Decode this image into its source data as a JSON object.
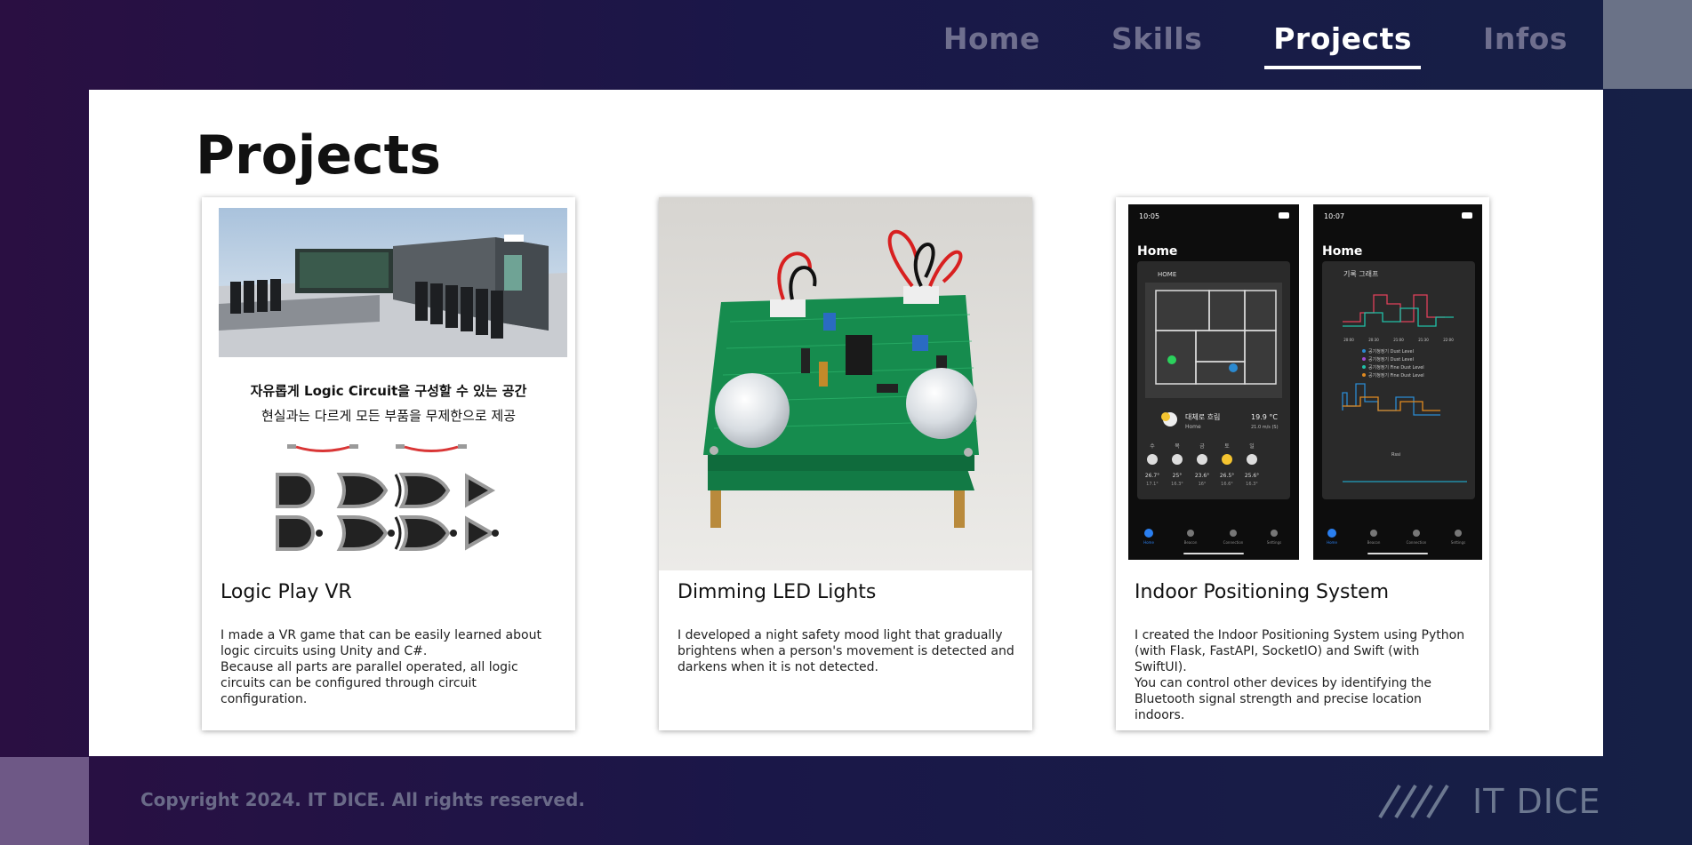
{
  "nav": {
    "items": [
      {
        "label": "Home"
      },
      {
        "label": "Skills"
      },
      {
        "label": "Projects"
      },
      {
        "label": "Infos"
      }
    ],
    "active": "Projects"
  },
  "page": {
    "title": "Projects"
  },
  "projects": [
    {
      "title": "Logic Play VR",
      "image_caption_line1": "자유롭게 Logic Circuit을 구성할 수 있는 공간",
      "image_caption_line2": "현실과는 다르게 모든 부품을 무제한으로 제공",
      "description": "I made a VR game that can be easily learned about logic circuits using Unity and C#.\nBecause all parts are parallel operated, all logic circuits can be configured through circuit configuration."
    },
    {
      "title": "Dimming LED Lights",
      "description": "I developed a night safety mood light that gradually brightens when a person's movement is detected and darkens when it is not detected."
    },
    {
      "title": "Indoor Positioning System",
      "phone1": {
        "time": "10:05",
        "heading": "Home",
        "card_label": "HOME",
        "weather_text": "대체로 흐림",
        "weather_place": "Home",
        "temp": "19.9 °C",
        "wind": "21.0 m/s (S)",
        "days": [
          "수",
          "목",
          "금",
          "토",
          "일"
        ],
        "highs": [
          "26.7°",
          "25°",
          "23.6°",
          "26.5°",
          "25.6°"
        ],
        "lows": [
          "17.1°",
          "16.3°",
          "16°",
          "16.6°",
          "16.3°"
        ]
      },
      "phone2": {
        "time": "10:07",
        "heading": "Home",
        "card_label": "기록 그래프",
        "legend": [
          "공기청정기 Dust Level",
          "공기청정기 Dust Level",
          "공기청정기 Fine Dust Level",
          "공기청정기 Fine Dust Level"
        ],
        "bottom_legend": "Rssi",
        "times": [
          "20:00",
          "20:30",
          "21:00",
          "21:30",
          "22:00"
        ]
      },
      "tabbar": [
        "Home",
        "Beacon",
        "Connection",
        "Settings"
      ],
      "description": "I created the Indoor Positioning System using Python (with Flask, FastAPI, SocketIO) and Swift (with SwiftUI).\nYou can control other devices by identifying the Bluetooth signal strength and precise location indoors."
    }
  ],
  "footer": {
    "copyright": "Copyright 2024. IT DICE. All rights reserved."
  },
  "logo": {
    "text": "IT DICE"
  },
  "colors": {
    "active_nav": "#ffffff",
    "inactive_nav": "#6f6f8e",
    "footer_text": "#6a6a88",
    "logo": "#6c7890"
  }
}
